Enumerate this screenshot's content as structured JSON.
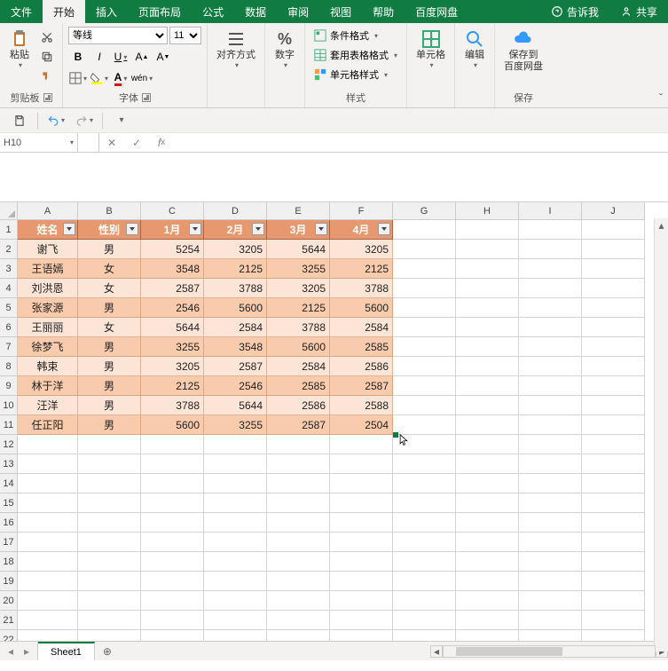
{
  "tabs": {
    "file": "文件",
    "home": "开始",
    "insert": "插入",
    "layout": "页面布局",
    "formulas": "公式",
    "data": "数据",
    "review": "审阅",
    "view": "视图",
    "help": "帮助",
    "baidu": "百度网盘",
    "tell_me": "告诉我",
    "share": "共享"
  },
  "ribbon": {
    "clipboard": {
      "label": "剪贴板",
      "paste": "粘贴"
    },
    "font": {
      "label": "字体",
      "name": "等线",
      "size": "11",
      "bold": "B",
      "italic": "I",
      "underline": "U",
      "wen": "wén"
    },
    "align": {
      "label": "对齐方式"
    },
    "number": {
      "label": "数字",
      "pct": "%"
    },
    "styles": {
      "label": "样式",
      "cond": "条件格式",
      "tbl": "套用表格格式",
      "cell": "单元格样式"
    },
    "cells": {
      "label": "单元格"
    },
    "editing": {
      "label": "编辑"
    },
    "save": {
      "btn": "保存到\n百度网盘",
      "label": "保存"
    }
  },
  "namebox": "H10",
  "columns": [
    "A",
    "B",
    "C",
    "D",
    "E",
    "F",
    "G",
    "H",
    "I",
    "J"
  ],
  "row_count": 22,
  "table": {
    "headers": [
      "姓名",
      "性别",
      "1月",
      "2月",
      "3月",
      "4月"
    ],
    "rows": [
      [
        "谢飞",
        "男",
        "5254",
        "3205",
        "5644",
        "3205"
      ],
      [
        "王语嫣",
        "女",
        "3548",
        "2125",
        "3255",
        "2125"
      ],
      [
        "刘洪恩",
        "女",
        "2587",
        "3788",
        "3205",
        "3788"
      ],
      [
        "张家源",
        "男",
        "2546",
        "5600",
        "2125",
        "5600"
      ],
      [
        "王丽丽",
        "女",
        "5644",
        "2584",
        "3788",
        "2584"
      ],
      [
        "徐梦飞",
        "男",
        "3255",
        "3548",
        "5600",
        "2585"
      ],
      [
        "韩束",
        "男",
        "3205",
        "2587",
        "2584",
        "2586"
      ],
      [
        "林于洋",
        "男",
        "2125",
        "2546",
        "2585",
        "2587"
      ],
      [
        "汪洋",
        "男",
        "3788",
        "5644",
        "2586",
        "2588"
      ],
      [
        "任正阳",
        "男",
        "5600",
        "3255",
        "2587",
        "2504"
      ]
    ]
  },
  "sheet_tab": "Sheet1"
}
